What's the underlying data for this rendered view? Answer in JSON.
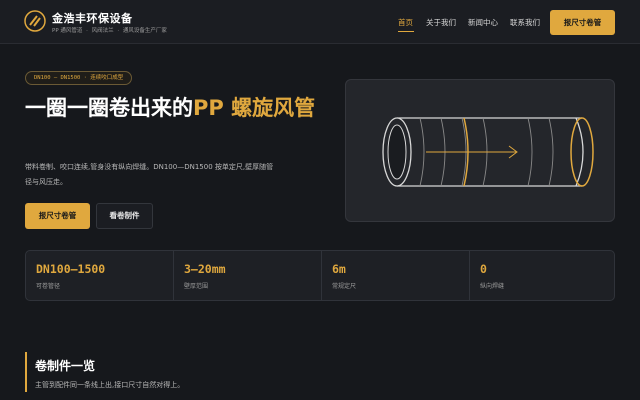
{
  "brand": {
    "name": "金浩丰环保设备",
    "tags": [
      "PP 通风管道",
      "·",
      "风阀法兰",
      "·",
      "通风设备生产厂家"
    ]
  },
  "nav": {
    "items": [
      "首页",
      "关于我们",
      "新闻中心",
      "联系我们"
    ],
    "active_index": 0,
    "cta_label": "报尺寸卷管"
  },
  "hero": {
    "badge": "DN100 — DN1500 · 连续咬口成型",
    "title_main": "一圈一圈卷出来的",
    "title_accent": "PP 螺旋风管",
    "description": "带料卷制、咬口连续,管身没有纵向焊缝。DN100—DN1500 按单定尺,壁厚随管径与风压走。",
    "primary_button": "报尺寸卷管",
    "secondary_button": "看卷制件"
  },
  "stats": [
    {
      "value": "DN100–1500",
      "label": "可卷管径"
    },
    {
      "value": "3–20mm",
      "label": "壁厚范围"
    },
    {
      "value": "6m",
      "label": "常规定尺"
    },
    {
      "value": "0",
      "label": "纵向焊缝"
    }
  ],
  "section": {
    "title": "卷制件一览",
    "subtitle": "主管到配件同一条线上出,接口尺寸自然对得上。"
  },
  "colors": {
    "accent": "#e0a83e",
    "background": "#16181c",
    "panel": "#24262b"
  },
  "icons": {
    "logo": "slashed-circle-logo",
    "hero_graphic": "spiral-pipe-illustration"
  }
}
